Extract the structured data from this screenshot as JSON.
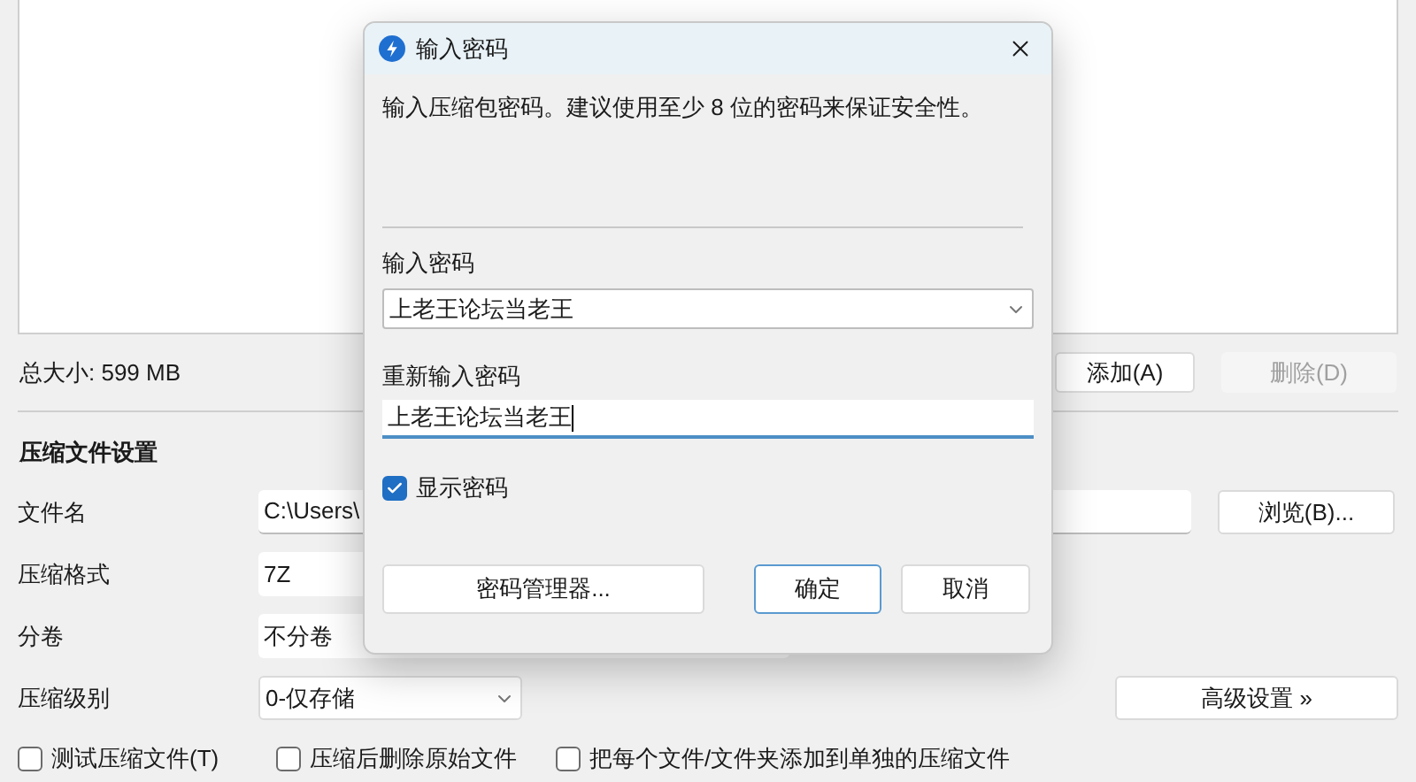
{
  "total_size": "总大小: 599 MB",
  "list_buttons": [
    {
      "label": "添加(A)",
      "disabled": false
    },
    {
      "label": "删除(D)",
      "disabled": true
    }
  ],
  "settings": {
    "heading": "压缩文件设置",
    "rows": [
      {
        "kind": "path",
        "label": "文件名",
        "value": "C:\\Users\\",
        "button": "浏览(B)..."
      },
      {
        "kind": "field",
        "label": "压缩格式",
        "value": "7Z"
      },
      {
        "kind": "field",
        "label": "分卷",
        "value": "不分卷"
      },
      {
        "kind": "select",
        "label": "压缩级别",
        "value": "0-仅存储",
        "button": "高级设置 »"
      }
    ]
  },
  "options": [
    {
      "label": "测试压缩文件(T)",
      "checked": false
    },
    {
      "label": "压缩后删除原始文件",
      "checked": false
    },
    {
      "label": "把每个文件/文件夹添加到单独的压缩文件",
      "checked": false
    }
  ],
  "dialog": {
    "title": "输入密码",
    "description": "输入压缩包密码。建议使用至少 8 位的密码来保证安全性。",
    "password_label": "输入密码",
    "password_value": "上老王论坛当老王",
    "confirm_label": "重新输入密码",
    "confirm_value": "上老王论坛当老王",
    "show_password": {
      "label": "显示密码",
      "checked": true
    },
    "buttons": [
      {
        "label": "密码管理器...",
        "default": false
      },
      {
        "label": "确定",
        "default": true
      },
      {
        "label": "取消",
        "default": false
      }
    ]
  }
}
